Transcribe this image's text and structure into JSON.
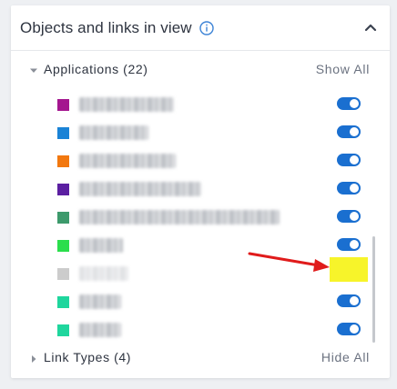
{
  "panel": {
    "title": "Objects and links in view",
    "info_icon": "info-icon",
    "collapse_icon": "chevron-up-icon"
  },
  "applications": {
    "label": "Applications (22)",
    "action": "Show All",
    "expanded": true,
    "items": [
      {
        "name": "Google_Analytics",
        "color": "#a4168f",
        "visible": true
      },
      {
        "name": "Google Ads",
        "color": "#1a83d6",
        "visible": true
      },
      {
        "name": "Google Play Store",
        "color": "#f2780f",
        "visible": true
      },
      {
        "name": "Ad Manager Integration",
        "color": "#5b1fa1",
        "visible": true
      },
      {
        "name": "Search Console Web App Verification Tag",
        "color": "#3d9a6c",
        "visible": true
      },
      {
        "name": "Firebase",
        "color": "#2bde4c",
        "visible": true
      },
      {
        "name": "Optimize",
        "color": "#cccccc",
        "visible": false
      },
      {
        "name": "Hotjar",
        "color": "#1fd69d",
        "visible": true
      },
      {
        "name": "Pixel Ads",
        "color": "#1fd69d",
        "visible": true
      }
    ]
  },
  "link_types": {
    "label": "Link Types (4)",
    "action": "Hide All",
    "expanded": false
  },
  "colors": {
    "toggle_on": "#1a6fd0",
    "highlight": "#f7f42a",
    "annotation_arrow": "#e01b1b"
  }
}
